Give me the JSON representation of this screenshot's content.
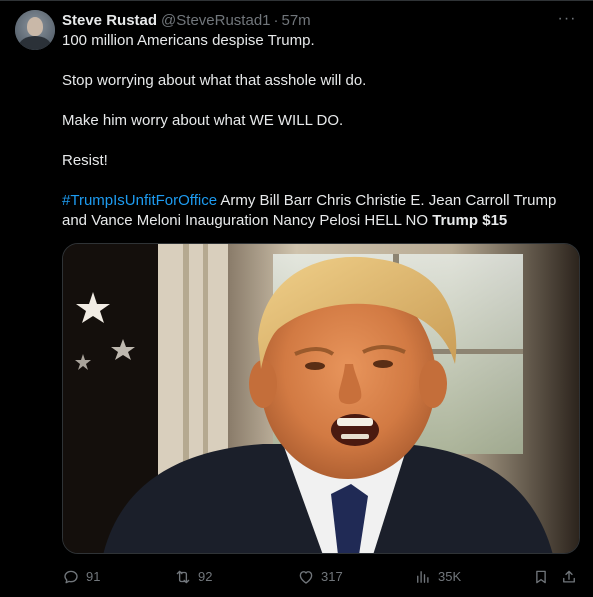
{
  "author": {
    "name": "Steve Rustad",
    "handle": "@SteveRustad1",
    "separator": "·",
    "time": "57m"
  },
  "more_label": "···",
  "tweet": {
    "line1": "100 million Americans despise Trump.",
    "line2": "Stop worrying about what that asshole will do.",
    "line3": "Make him worry about what WE WILL DO.",
    "line4": "Resist!",
    "hashtag": "#TrumpIsUnfitForOffice",
    "trends": " Army Bill Barr Chris Christie E. Jean Carroll Trump and Vance Meloni Inauguration Nancy Pelosi HELL NO ",
    "bold_tail": "Trump $15"
  },
  "actions": {
    "replies": "91",
    "reposts": "92",
    "likes": "317",
    "views": "35K"
  },
  "icons": {
    "reply": "reply-icon",
    "repost": "repost-icon",
    "like": "heart-icon",
    "views": "views-icon",
    "bookmark": "bookmark-icon",
    "share": "share-icon"
  },
  "colors": {
    "background": "#000000",
    "text": "#e7e9ea",
    "secondary": "#71767b",
    "link": "#1d9bf0",
    "border": "#2f3336"
  }
}
